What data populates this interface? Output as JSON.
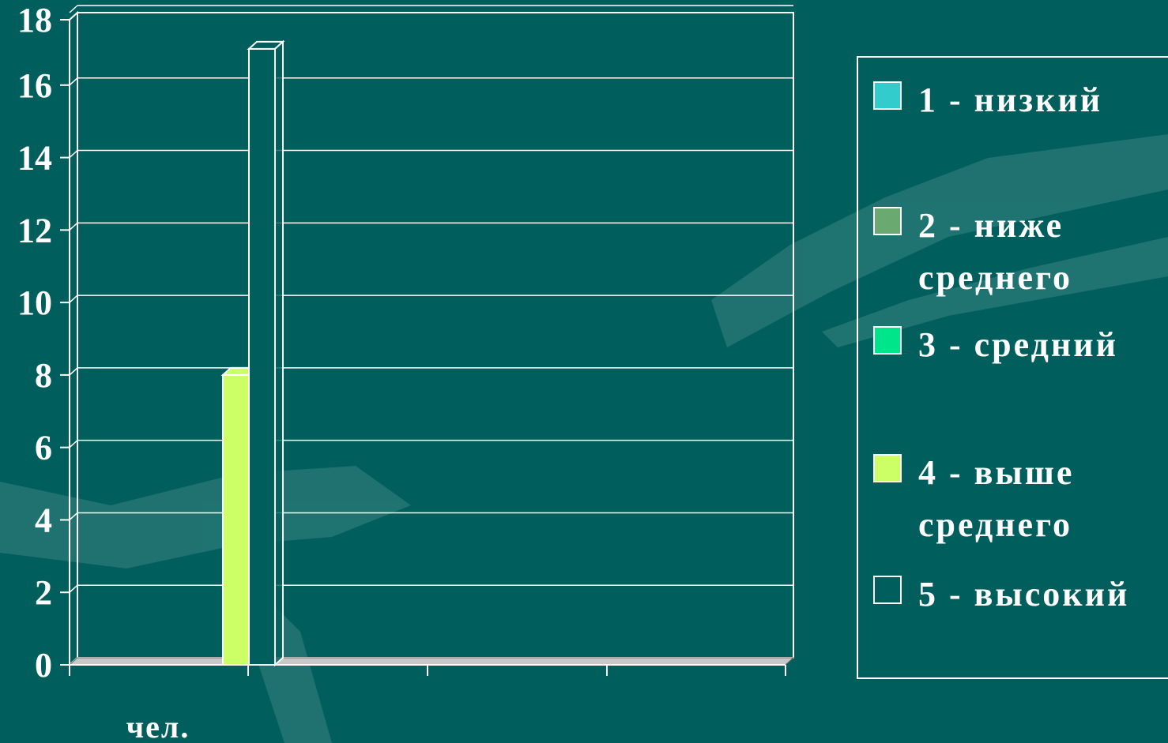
{
  "chart_data": {
    "type": "bar",
    "categories": [
      "чел."
    ],
    "series": [
      {
        "name": "1 - низкий",
        "values": [
          0
        ],
        "color": "#33cccc"
      },
      {
        "name": "2 - ниже среднего",
        "values": [
          0
        ],
        "color": "#6aaa70"
      },
      {
        "name": "3 - средний",
        "values": [
          0
        ],
        "color": "#00e58a"
      },
      {
        "name": "4 - выше среднего",
        "values": [
          8
        ],
        "color": "#ccff66"
      },
      {
        "name": "5 - высокий",
        "values": [
          17
        ],
        "color": "#005f5c"
      }
    ],
    "legend_lines": [
      [
        "1 - низкий"
      ],
      [
        "2 - ниже",
        "среднего"
      ],
      [
        "3 - средний"
      ],
      [
        "4 - выше",
        "среднего"
      ],
      [
        "5 - высокий"
      ]
    ],
    "y_ticks": [
      "0",
      "2",
      "4",
      "6",
      "8",
      "10",
      "12",
      "14",
      "16",
      "18"
    ],
    "ylim": [
      0,
      18
    ],
    "grid": true,
    "legend_position": "right",
    "background_color": "#005f5c"
  }
}
